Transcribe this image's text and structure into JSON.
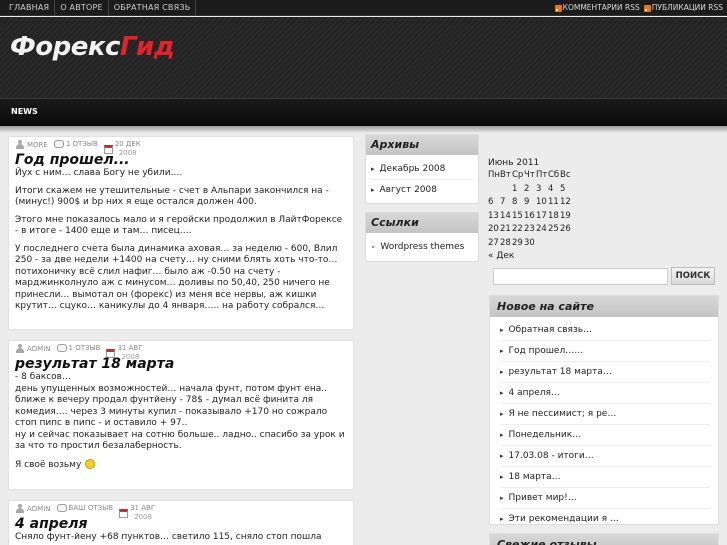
{
  "topnav": {
    "items": [
      "ГЛАВНАЯ",
      "О АВТОРЕ",
      "ОБРАТНАЯ СВЯЗЬ"
    ],
    "rss": [
      "КОММЕНТАРИИ RSS",
      "ПУБЛИКАЦИИ RSS"
    ]
  },
  "header": {
    "logo_part1": "Форекс",
    "logo_part2": "Гид"
  },
  "navbar": {
    "news": "NEWS"
  },
  "posts": [
    {
      "author": "MORE",
      "comments": "1 ОТЗЫВ",
      "date": "20 ДЕК",
      "year": "2008",
      "title": "Год прошел...",
      "paragraphs": [
        "Йух с ним… слава Богу не убили….",
        "Итоги скажем не утешительные - счет в Альпари закончился на - (минус!) 900$ и bp них я еще остался должен 400.",
        "Этого мне показалось мало и я геройски продолжил в ЛайтФорексе - в итоге - 1400 еще и там… писец….",
        "У последнего счета была динамика аховая… за неделю - 600, Влил 250 - за две недели +1400 на счету… ну сними блять хоть что-то… потихоничку всё слил нафиг… было аж -0.50 на счету - марджинколнуло аж с минусом… доливы по 50,40, 250 ничего не принесли… вымотал он (форекс) из меня все нервы, аж кишки крутит… сцуко… каникулы до 4 января….. на работу собрался…"
      ]
    },
    {
      "author": "ADMIN",
      "comments": "1 ОТЗЫВ",
      "date": "31 АВГ",
      "year": "2008",
      "title": "результат 18 марта",
      "lines": [
        "- 8 баксов…",
        "день упущенных возможностей… начала фунт, потом фунт ена.. ближе к вечеру продал фунтйену - 78$ - думал всё финита ля комедия…. через 3 минуты купил - показывало +170 но сожрало стоп пипс в пипс - и оставило + 97..",
        "ну и сейчас показывает на сотню больше.. ладно.. спасибо за урок и за что то простил безалаберность."
      ],
      "closing": "Я своё возьму"
    },
    {
      "author": "ADMIN",
      "comments": "ВАШ ОТЗЫВ",
      "date": "31 АВГ",
      "year": "2008",
      "title": "4 апреля",
      "first_line": "Сняло фунт-йену +68 пунктов… светило 115, сняло стоп пошла"
    }
  ],
  "archives": {
    "title": "Архивы",
    "items": [
      "Декабрь 2008",
      "Август 2008"
    ]
  },
  "links": {
    "title": "Ссылки",
    "items": [
      "Wordpress themes"
    ]
  },
  "calendar": {
    "caption": "Июнь 2011",
    "weekdays": [
      "Пн",
      "Вт",
      "Ср",
      "Чт",
      "Пт",
      "Сб",
      "Вс"
    ],
    "rows": [
      [
        "",
        "",
        "1",
        "2",
        "3",
        "4",
        "5"
      ],
      [
        "6",
        "7",
        "8",
        "9",
        "10",
        "11",
        "12"
      ],
      [
        "13",
        "14",
        "15",
        "16",
        "17",
        "18",
        "19"
      ],
      [
        "20",
        "21",
        "22",
        "23",
        "24",
        "25",
        "26"
      ],
      [
        "27",
        "28",
        "29",
        "30",
        "",
        "",
        ""
      ]
    ],
    "prev": "« Дек"
  },
  "search": {
    "placeholder": "",
    "button": "ПОИСК"
  },
  "recent": {
    "title": "Новое на сайте",
    "items": [
      "Обратная связь…",
      "Год прошел……",
      "результат 18 марта…",
      "4 апреля…",
      "Я не пессимист; я ре…",
      "Понедельник…",
      "17.03.08 - итоги…",
      "18 марта…",
      "Привет мир!…",
      "Эти рекомендации я …"
    ]
  },
  "fresh": {
    "title": "Свежие отзывы"
  }
}
